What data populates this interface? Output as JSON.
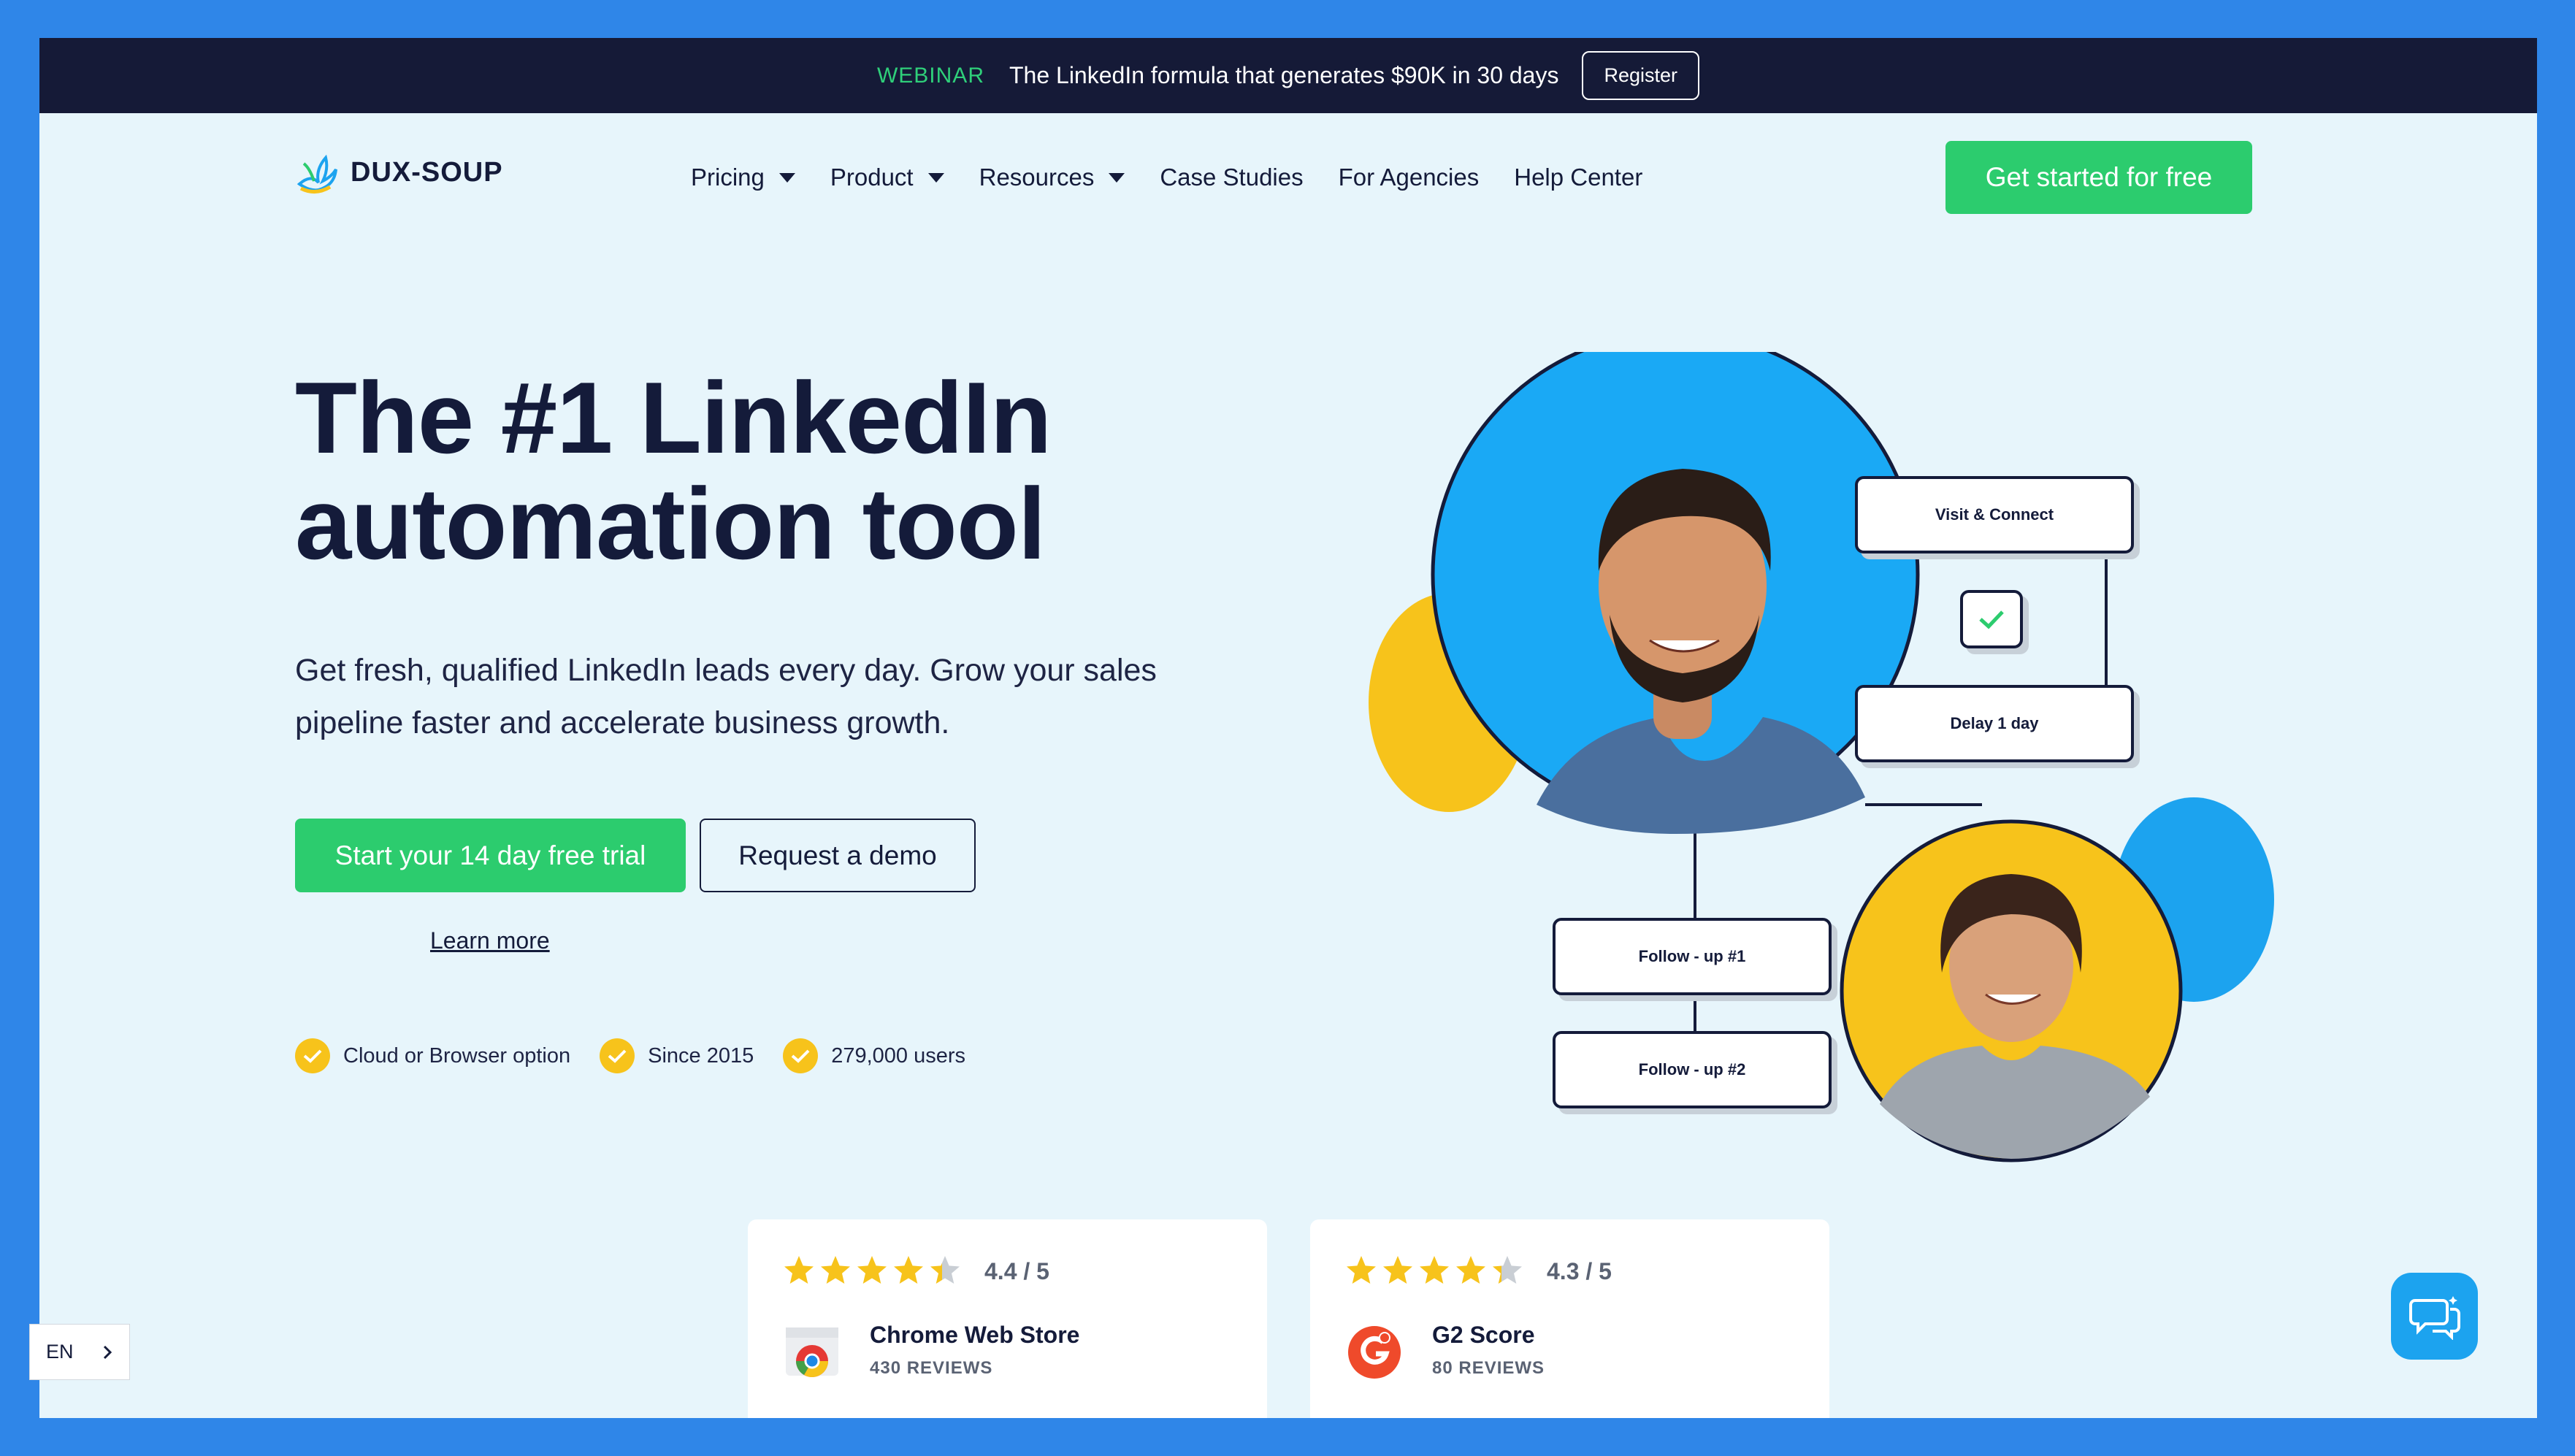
{
  "banner": {
    "tag": "WEBINAR",
    "message": "The LinkedIn formula that generates $90K in 30 days",
    "register_label": "Register"
  },
  "header": {
    "logo_text": "DUX-SOUP",
    "nav": [
      {
        "label": "Pricing",
        "dropdown": true
      },
      {
        "label": "Product",
        "dropdown": true
      },
      {
        "label": "Resources",
        "dropdown": true
      },
      {
        "label": "Case Studies",
        "dropdown": false
      },
      {
        "label": "For Agencies",
        "dropdown": false
      },
      {
        "label": "Help Center",
        "dropdown": false
      }
    ],
    "cta_label": "Get started for free"
  },
  "hero": {
    "title_line1": "The #1 LinkedIn",
    "title_line2": "automation tool",
    "subtitle_line1": "Get fresh, qualified LinkedIn leads every day. Grow your sales",
    "subtitle_line2": "pipeline faster and accelerate business growth.",
    "primary_button": "Start your 14 day free trial",
    "secondary_button": "Request a demo",
    "learn_more": "Learn more",
    "checks": [
      "Cloud or Browser option",
      "Since 2015",
      "279,000 users"
    ]
  },
  "illustration": {
    "steps": [
      "Visit & Connect",
      "Delay 1 day",
      "Follow - up #1",
      "Follow - up #2"
    ]
  },
  "reviews": [
    {
      "score": "4.4 / 5",
      "rating": 4.4,
      "name": "Chrome Web Store",
      "count": "430 REVIEWS",
      "icon": "chrome-store-icon"
    },
    {
      "score": "4.3 / 5",
      "rating": 4.3,
      "name": "G2 Score",
      "count": "80 REVIEWS",
      "icon": "g2-icon"
    }
  ],
  "language": {
    "code": "EN"
  },
  "colors": {
    "brand_green": "#2ccc6e",
    "navy": "#141b3a",
    "page_bg": "#e7f5fb",
    "star_yellow": "#f7c31b",
    "chat_blue": "#1ca3ef"
  }
}
